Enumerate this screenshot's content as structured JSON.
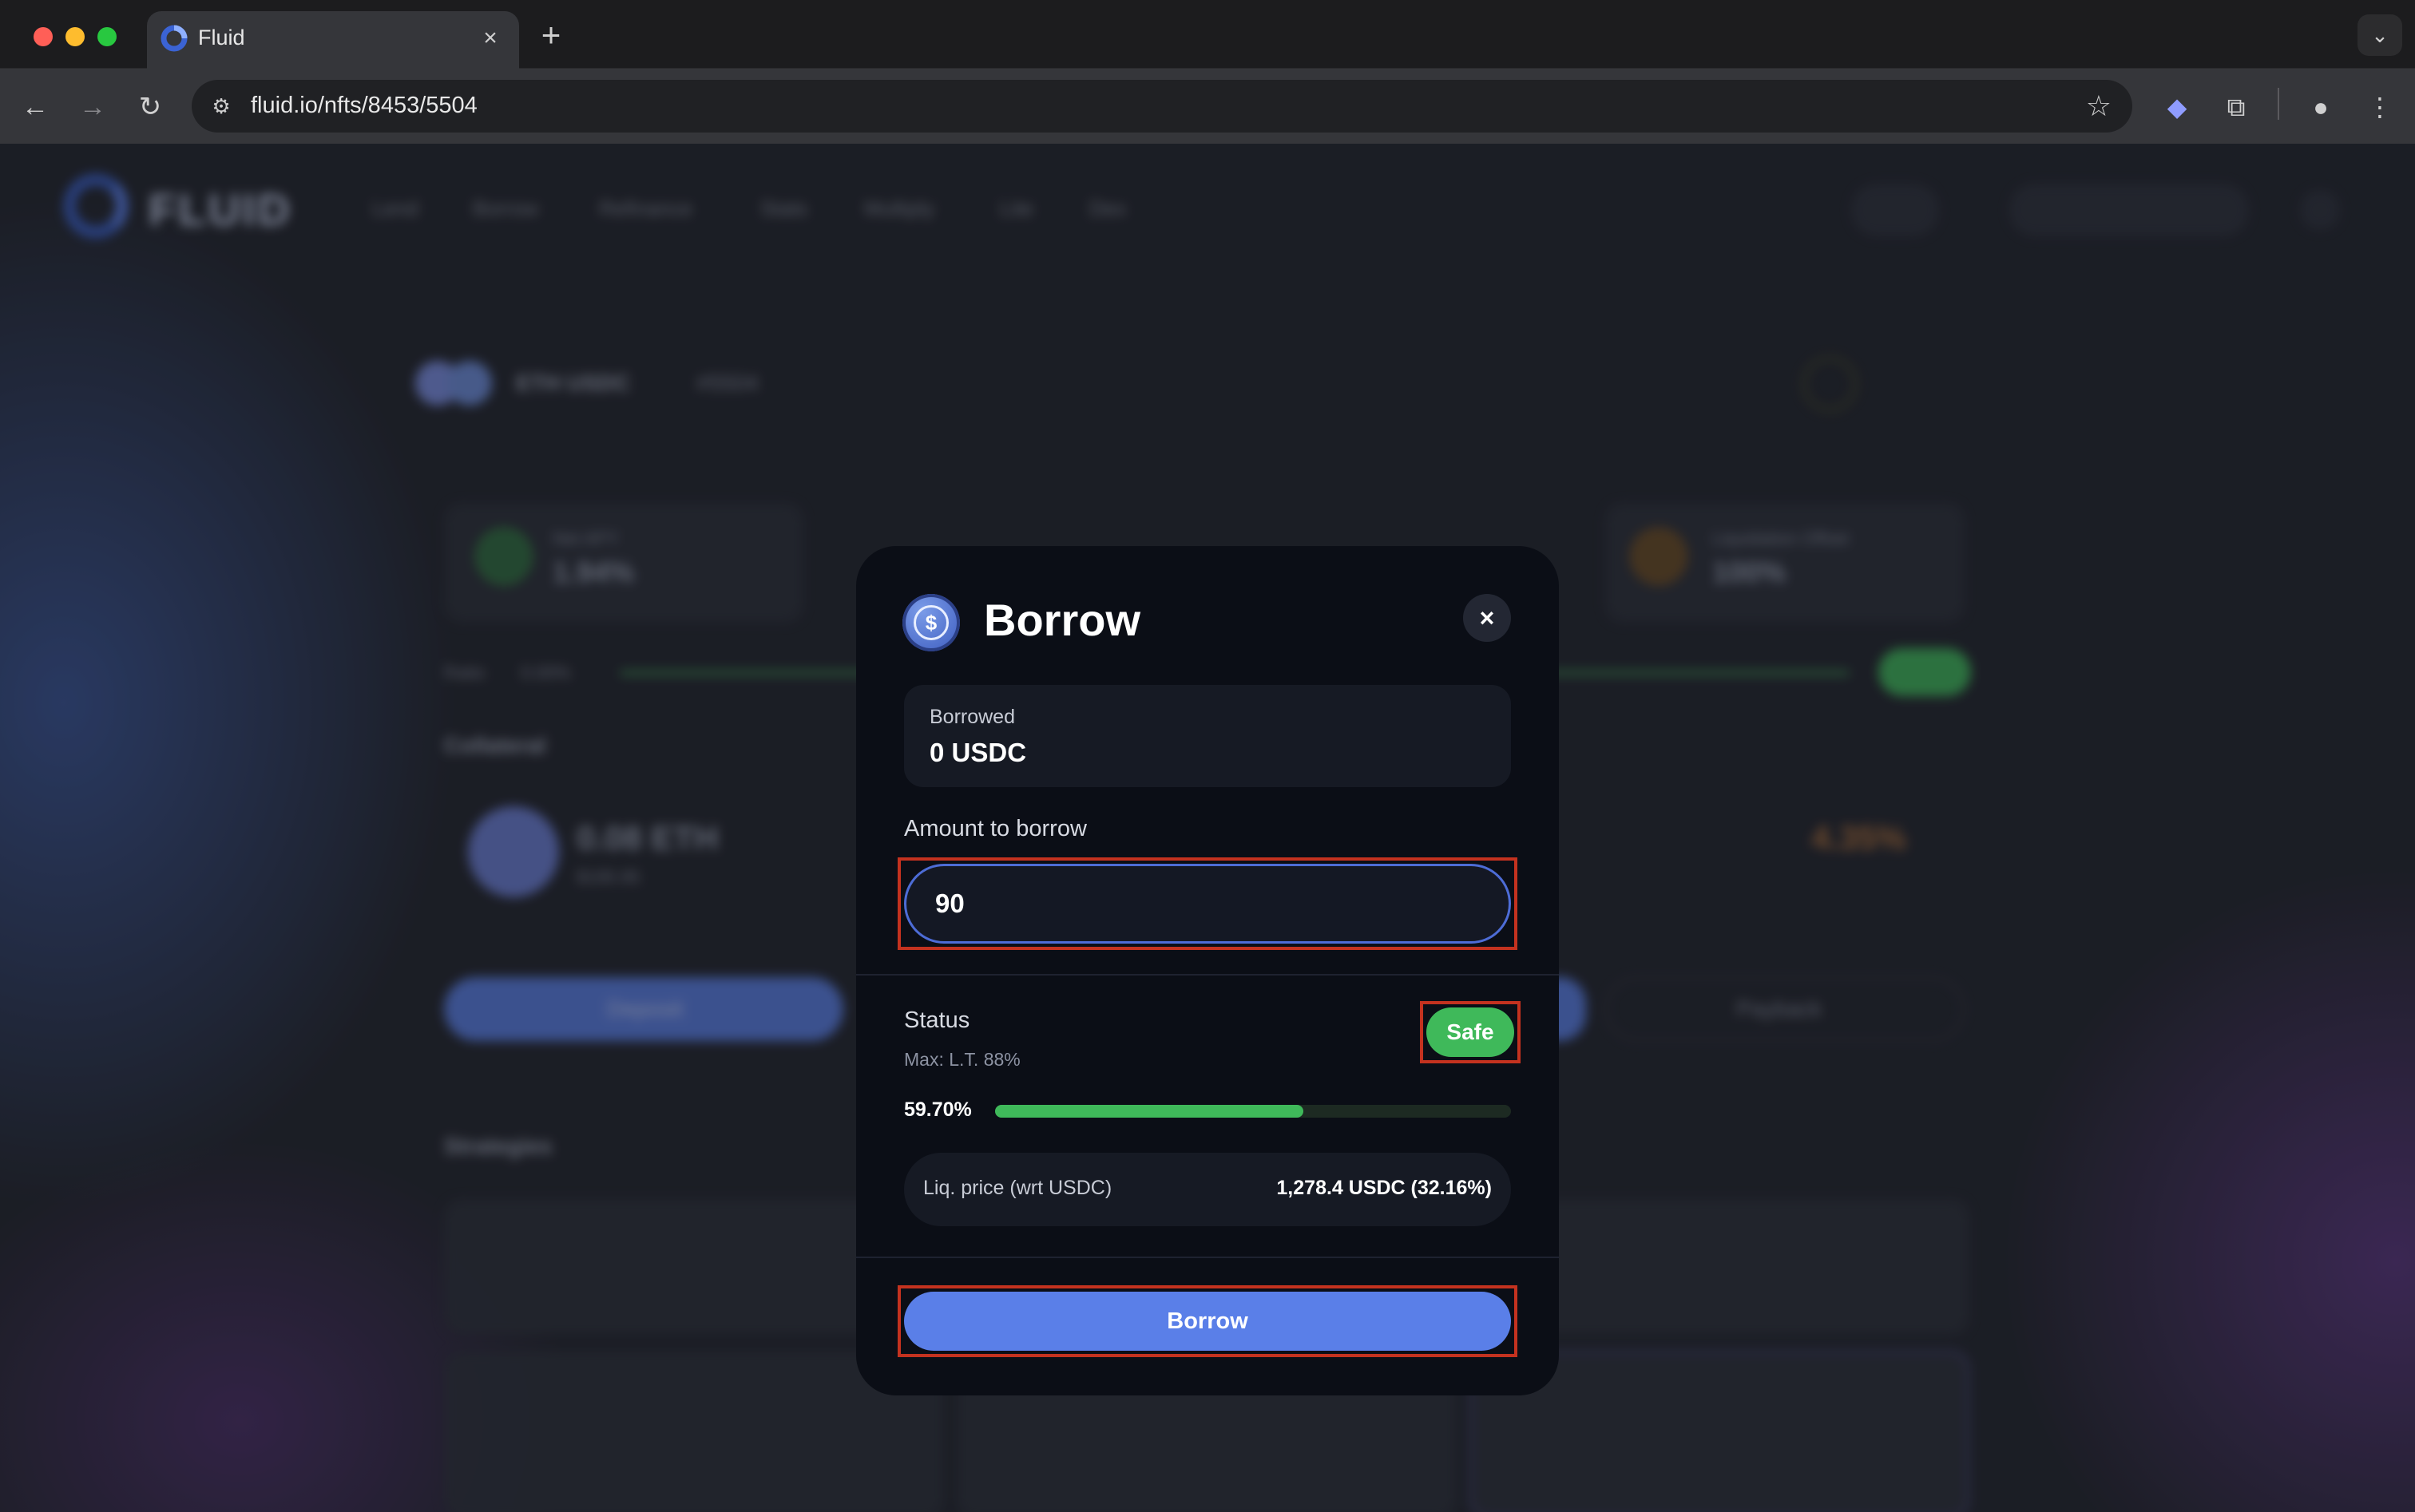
{
  "browser": {
    "tab_title": "Fluid",
    "tab_close": "×",
    "new_tab": "+",
    "url": "fluid.io/nfts/8453/5504",
    "icons": [
      "back-icon",
      "forward-icon",
      "reload-icon",
      "site-info-icon",
      "bookmark-star-icon",
      "extension-icon",
      "puzzle-icon",
      "profile-icon",
      "menu-icon",
      "tab-search-icon"
    ]
  },
  "background": {
    "brand": "FLUID",
    "nav": [
      "Lend",
      "Borrow",
      "Refinance",
      "Stats",
      "Multiply",
      "Lite",
      "Dex"
    ],
    "pair": "ETH  USDC",
    "nft_id": "#5504",
    "net_apy_label": "Net APY",
    "net_apy_value": "1.94%",
    "liq_label": "Liquidation Offset",
    "liq_value": "100%",
    "ratio_label": "Ratio",
    "ratio_value": "0.00%",
    "collateral_heading": "Collateral",
    "collateral_amount": "0.08 ETH",
    "collateral_usd": "$195.95",
    "deposit_btn": "Deposit",
    "payback_btn": "Payback",
    "strategies_heading": "Strategies",
    "supply_rate": "4.35%"
  },
  "modal": {
    "title": "Borrow",
    "close": "×",
    "icon_glyph": "$",
    "borrowed_label": "Borrowed",
    "borrowed_value": "0 USDC",
    "amount_label": "Amount to borrow",
    "amount_value": "90",
    "status_label": "Status",
    "max_lt": "Max: L.T. 88%",
    "status_badge": "Safe",
    "ratio_text": "59.70%",
    "ratio_fraction": 0.597,
    "liq_price_label": "Liq. price (wrt USDC)",
    "liq_price_value": "1,278.4 USDC  (32.16%)",
    "submit_label": "Borrow"
  },
  "colors": {
    "accent": "#5a7fe8",
    "safe": "#3fb95a",
    "highlight": "#c4321f",
    "modal_bg": "#0b0e16"
  }
}
